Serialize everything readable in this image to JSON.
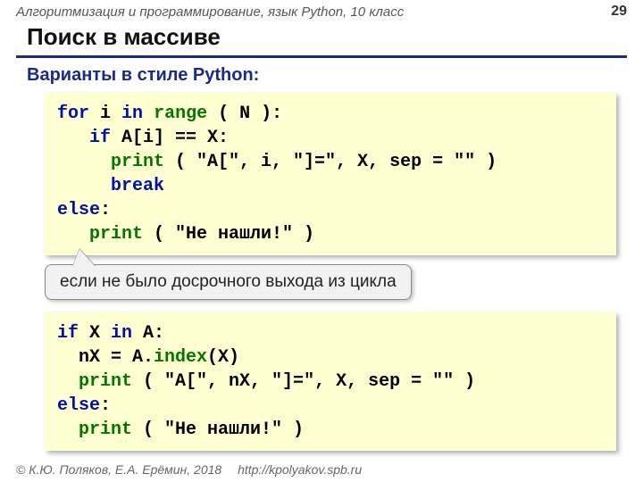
{
  "header": {
    "course": "Алгоритмизация и программирование, язык Python, 10 класс",
    "slide_no": "29"
  },
  "title": "Поиск в массиве",
  "subtitle": "Варианты в стиле Python:",
  "code1": {
    "l1_for": "for",
    "l1_i": " i ",
    "l1_in": "in",
    "l1_sp": " ",
    "l1_range": "range",
    "l1_tail": " ( N ):",
    "l2_lead": "   ",
    "l2_if": "if",
    "l2_tail": " A[i] == X:",
    "l3_lead": "     ",
    "l3_print": "print",
    "l3_tail": " ( \"A[\", i, \"]=\", X, sep = \"\" )",
    "l4_lead": "     ",
    "l4_break": "break",
    "l5_else": "else",
    "l5_colon": ":",
    "l6_lead": "   ",
    "l6_print": "print",
    "l6_tail": " ( \"Не нашли!\" )"
  },
  "callout": "если не было досрочного выхода из цикла",
  "code2": {
    "l1_if": "if",
    "l1_mid": " X ",
    "l1_in": "in",
    "l1_tail": " A:",
    "l2_lead": "  nX = A.",
    "l2_index": "index",
    "l2_tail": "(X)",
    "l3_lead": "  ",
    "l3_print": "print",
    "l3_tail": " ( \"A[\", nX, \"]=\", X, sep = \"\" )",
    "l4_else": "else",
    "l4_colon": ":",
    "l5_lead": "  ",
    "l5_print": "print",
    "l5_tail": " ( \"Не нашли!\" )"
  },
  "footer": {
    "copyright": "© К.Ю. Поляков, Е.А. Ерёмин, 2018",
    "url": "http://kpolyakov.spb.ru"
  }
}
